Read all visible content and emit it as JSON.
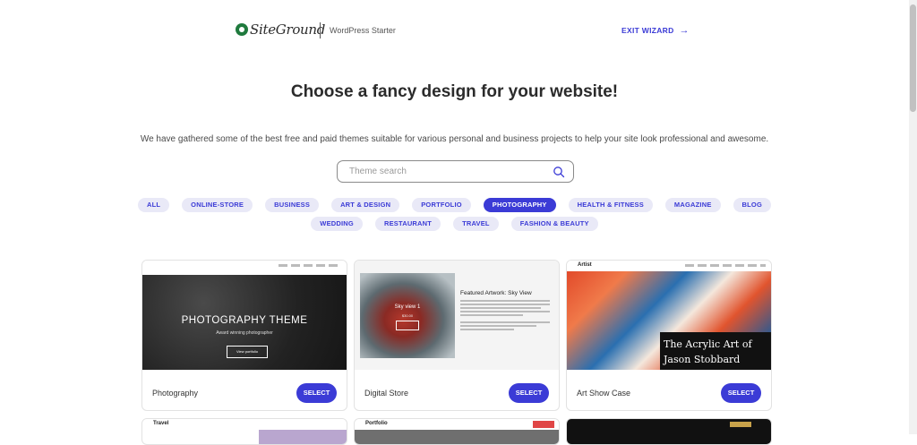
{
  "header": {
    "logo_text": "SiteGround",
    "product_name": "WordPress Starter",
    "exit_label": "EXIT WIZARD"
  },
  "title": "Choose a fancy design for your website!",
  "subtitle": "We have gathered some of the best free and paid themes suitable for various personal and business projects to help your site look professional and awesome.",
  "search": {
    "placeholder": "Theme search"
  },
  "categories": {
    "row1": [
      "ALL",
      "ONLINE-STORE",
      "BUSINESS",
      "ART & DESIGN",
      "PORTFOLIO",
      "PHOTOGRAPHY",
      "HEALTH & FITNESS",
      "MAGAZINE",
      "BLOG"
    ],
    "row2": [
      "WEDDING",
      "RESTAURANT",
      "TRAVEL",
      "FASHION & BEAUTY"
    ],
    "active": "PHOTOGRAPHY"
  },
  "themes": [
    {
      "name": "Photography",
      "select_label": "SELECT",
      "preview": {
        "heading": "PHOTOGRAPHY THEME",
        "tagline": "Award winning photographer",
        "button": "View portfolio"
      }
    },
    {
      "name": "Digital Store",
      "select_label": "SELECT",
      "preview": {
        "product": "Sky view 1",
        "price": "$30.00",
        "heading": "Featured Artwork: Sky View"
      }
    },
    {
      "name": "Art Show Case",
      "select_label": "SELECT",
      "preview": {
        "brand": "Artist",
        "line1": "The Acrylic Art of",
        "line2": "Jason Stobbard"
      }
    }
  ],
  "next_themes": [
    {
      "brand": "Travel"
    },
    {
      "brand": "Portfolio"
    },
    {
      "brand": ""
    }
  ],
  "colors": {
    "accent": "#3b3bd6",
    "chip_bg": "#e9e9f7",
    "logo_green": "#1f7a3d"
  }
}
